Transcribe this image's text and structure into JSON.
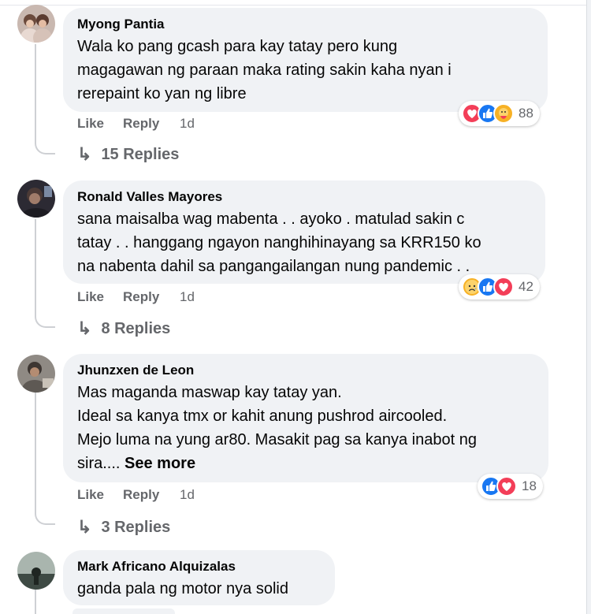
{
  "comments": [
    {
      "author": "Myong Pantia",
      "text": "Wala ko pang gcash para kay tatay pero kung\nmagagawan ng paraan maka rating sakin kaha nyan i\nrerepaint ko yan ng libre",
      "like_label": "Like",
      "reply_label": "Reply",
      "time": "1d",
      "reactions": [
        "love",
        "like",
        "care"
      ],
      "reaction_count": "88",
      "replies": "15 Replies"
    },
    {
      "author": "Ronald Valles Mayores",
      "text": "sana maisalba wag mabenta . . ayoko . matulad sakin c\ntatay . . hanggang ngayon nanghihinayang sa KRR150 ko\nna nabenta dahil sa pangangailangan nung pandemic . .",
      "like_label": "Like",
      "reply_label": "Reply",
      "time": "1d",
      "reactions": [
        "sad",
        "like",
        "love"
      ],
      "reaction_count": "42",
      "replies": "8 Replies"
    },
    {
      "author": "Jhunzxen de Leon",
      "text": "Mas maganda maswap kay tatay yan.\nIdeal sa kanya tmx or kahit anung pushrod aircooled.\nMejo luma na yung ar80. Masakit pag sa kanya inabot ng\nsira....",
      "see_more": "See more",
      "like_label": "Like",
      "reply_label": "Reply",
      "time": "1d",
      "reactions": [
        "like",
        "love"
      ],
      "reaction_count": "18",
      "replies": "3 Replies"
    },
    {
      "author": "Mark Africano Alquizalas",
      "text": "ganda pala ng motor nya solid"
    }
  ],
  "colors": {
    "bubble": "#f0f2f5",
    "meta": "#65676b",
    "like_blue": "#1877f2",
    "love_red": "#f33e58",
    "care_yellow": "#f7b125"
  }
}
